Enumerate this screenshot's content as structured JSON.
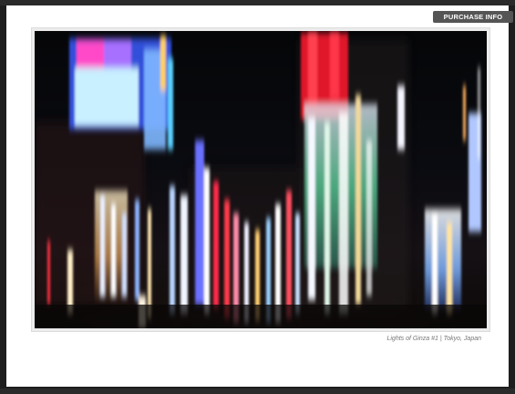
{
  "toolbar": {
    "purchase_label": "PURCHASE INFO"
  },
  "photo": {
    "caption": "Lights of Ginza #1 | Tokyo, Japan"
  }
}
